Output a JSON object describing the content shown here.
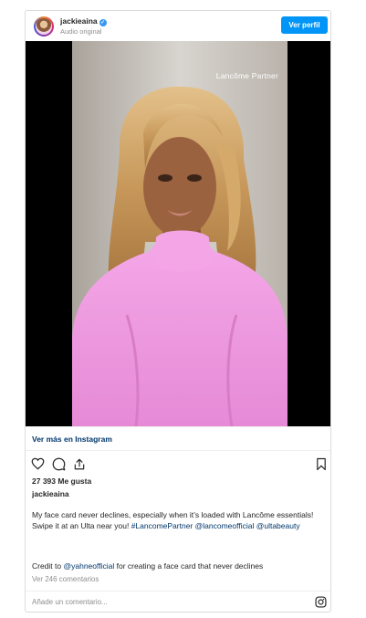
{
  "header": {
    "username": "jackieaina",
    "subtitle": "Audio original",
    "profile_button": "Ver perfil"
  },
  "media": {
    "overlay_text": "Lancôme Partner"
  },
  "view_more": "Ver más en Instagram",
  "actions": {
    "icons": [
      "heart-icon",
      "comment-icon",
      "share-icon",
      "bookmark-icon"
    ]
  },
  "likes": "27 393 Me gusta",
  "owner": "jackieaina",
  "caption": {
    "line1": "My face card never declines, especially when it’s loaded with Lancôme essentials!",
    "line2_text": "Swipe it at an Ulta near you!",
    "tag1": "#LancomePartner",
    "mention1": "@lancomeofficial",
    "mention2": "@ultabeauty"
  },
  "credit": {
    "prefix": "Credit to",
    "mention": "@yahneofficial",
    "suffix": "for creating a face card that never declines"
  },
  "view_comments": "Ver 246 comentarios",
  "comment_placeholder": "Añade un comentario...",
  "colors": {
    "accent": "#0095f6",
    "link": "#00376b",
    "muted": "#8e8e8e"
  }
}
